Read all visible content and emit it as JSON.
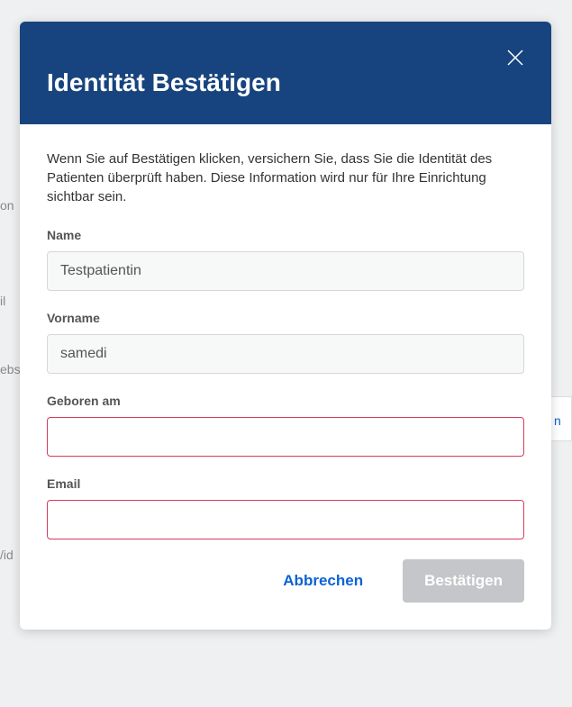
{
  "modal": {
    "title": "Identität Bestätigen",
    "description": "Wenn Sie auf Bestätigen klicken, versichern Sie, dass Sie die Identität des Patienten überprüft haben. Diese Information wird nur für Ihre Einrichtung sichtbar sein.",
    "fields": {
      "name": {
        "label": "Name",
        "value": "Testpatientin"
      },
      "vorname": {
        "label": "Vorname",
        "value": "samedi"
      },
      "geboren": {
        "label": "Geboren am",
        "value": ""
      },
      "email": {
        "label": "Email",
        "value": ""
      }
    },
    "buttons": {
      "cancel": "Abbrechen",
      "confirm": "Bestätigen"
    }
  },
  "background": {
    "hint1": "on",
    "hint2": "il",
    "hint3": "ebs",
    "hint4": "/id",
    "box": "n"
  }
}
